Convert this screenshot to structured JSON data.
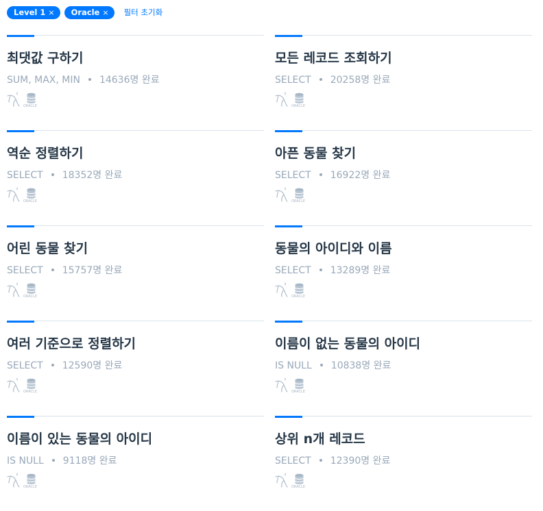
{
  "filters": {
    "chips": [
      {
        "label": "Level 1"
      },
      {
        "label": "Oracle"
      }
    ],
    "chip_close": "×",
    "reset_label": "필터 초기화"
  },
  "cards": [
    {
      "title": "최댓값 구하기",
      "category": "SUM, MAX, MIN",
      "completed": "14636명 완료"
    },
    {
      "title": "모든 레코드 조회하기",
      "category": "SELECT",
      "completed": "20258명 완료"
    },
    {
      "title": "역순 정렬하기",
      "category": "SELECT",
      "completed": "18352명 완료"
    },
    {
      "title": "아픈 동물 찾기",
      "category": "SELECT",
      "completed": "16922명 완료"
    },
    {
      "title": "어린 동물 찾기",
      "category": "SELECT",
      "completed": "15757명 완료"
    },
    {
      "title": "동물의 아이디와 이름",
      "category": "SELECT",
      "completed": "13289명 완료"
    },
    {
      "title": "여러 기준으로 정렬하기",
      "category": "SELECT",
      "completed": "12590명 완료"
    },
    {
      "title": "이름이 없는 동물의 아이디",
      "category": "IS NULL",
      "completed": "10838명 완료"
    },
    {
      "title": "이름이 있는 동물의 아이디",
      "category": "IS NULL",
      "completed": "9118명 완료"
    },
    {
      "title": "상위 n개 레코드",
      "category": "SELECT",
      "completed": "12390명 완료"
    }
  ],
  "icons": [
    "mysql-icon",
    "oracle-icon"
  ],
  "colors": {
    "accent": "#0078ff",
    "title": "#263747",
    "meta": "#98a8b9",
    "divider": "#d7e2eb"
  }
}
